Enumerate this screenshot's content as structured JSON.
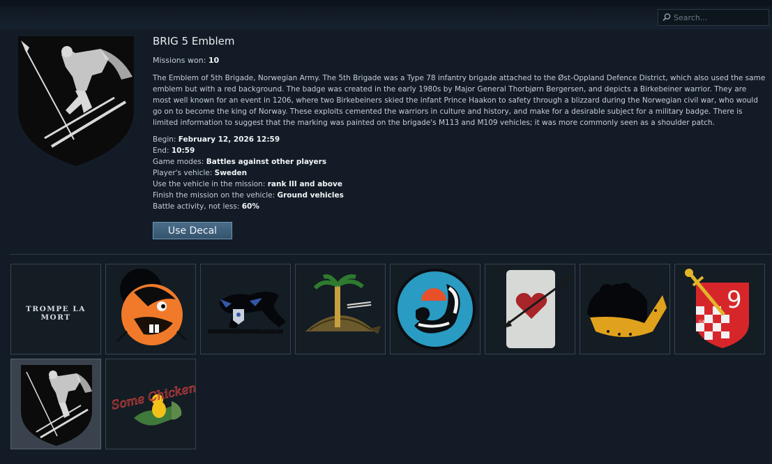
{
  "search": {
    "placeholder": "Search..."
  },
  "decal": {
    "title": "BRIG 5 Emblem",
    "missions_label": "Missions won: ",
    "missions_value": "10",
    "description": "The Emblem of 5th Brigade, Norwegian Army. The 5th Brigade was a Type 78 infantry brigade attached to the Øst-Oppland Defence District, which also used the same emblem but with a red background. The badge was created in the early 1980s by Major General Thorbjørn Bergersen, and depicts a Birkebeiner warrior. They are most well known for an event in 1206, where two Birkebeiners skied the infant Prince Haakon to safety through a blizzard during the Norwegian civil war, who would go on to become the king of Norway. These exploits cemented the warriors in culture and history, and make for a desirable subject for a military badge. There is limited information to suggest that the marking was painted on the brigade's M113 and M109 vehicles; it was more commonly seen as a shoulder patch.",
    "conditions": [
      {
        "label": "Begin: ",
        "value": "February 12, 2026 12:59"
      },
      {
        "label": "End: ",
        "value": "10:59"
      },
      {
        "label": "Game modes: ",
        "value": "Battles against other players"
      },
      {
        "label": "Player's vehicle: ",
        "value": "Sweden"
      },
      {
        "label": "Use the vehicle in the mission: ",
        "value": "rank III and above"
      },
      {
        "label": "Finish the mission on the vehicle: ",
        "value": "Ground vehicles"
      },
      {
        "label": "Battle activity, not less: ",
        "value": "60%"
      }
    ],
    "use_button": "Use Decal"
  },
  "tiles": [
    {
      "icon": "trompe-la-mort-text-decal",
      "text": "TROMPE LA MORT"
    },
    {
      "icon": "orange-beaver-decal"
    },
    {
      "icon": "black-panther-1972-decal",
      "text": "1972"
    },
    {
      "icon": "palm-turtle-decal"
    },
    {
      "icon": "skunk-roundel-decal"
    },
    {
      "icon": "heart-arrow-card-decal"
    },
    {
      "icon": "frog-scarf-decal"
    },
    {
      "icon": "sword-nine-shield-decal",
      "text": "9",
      "subtext": "GANGE"
    },
    {
      "icon": "brig-5-emblem-decal",
      "selected": true
    },
    {
      "icon": "some-chicken-decal",
      "text": "Some Chicken"
    }
  ],
  "colors": {
    "background": "#131c26",
    "accent": "#4a6d8a",
    "tile_border": "#39444f"
  }
}
